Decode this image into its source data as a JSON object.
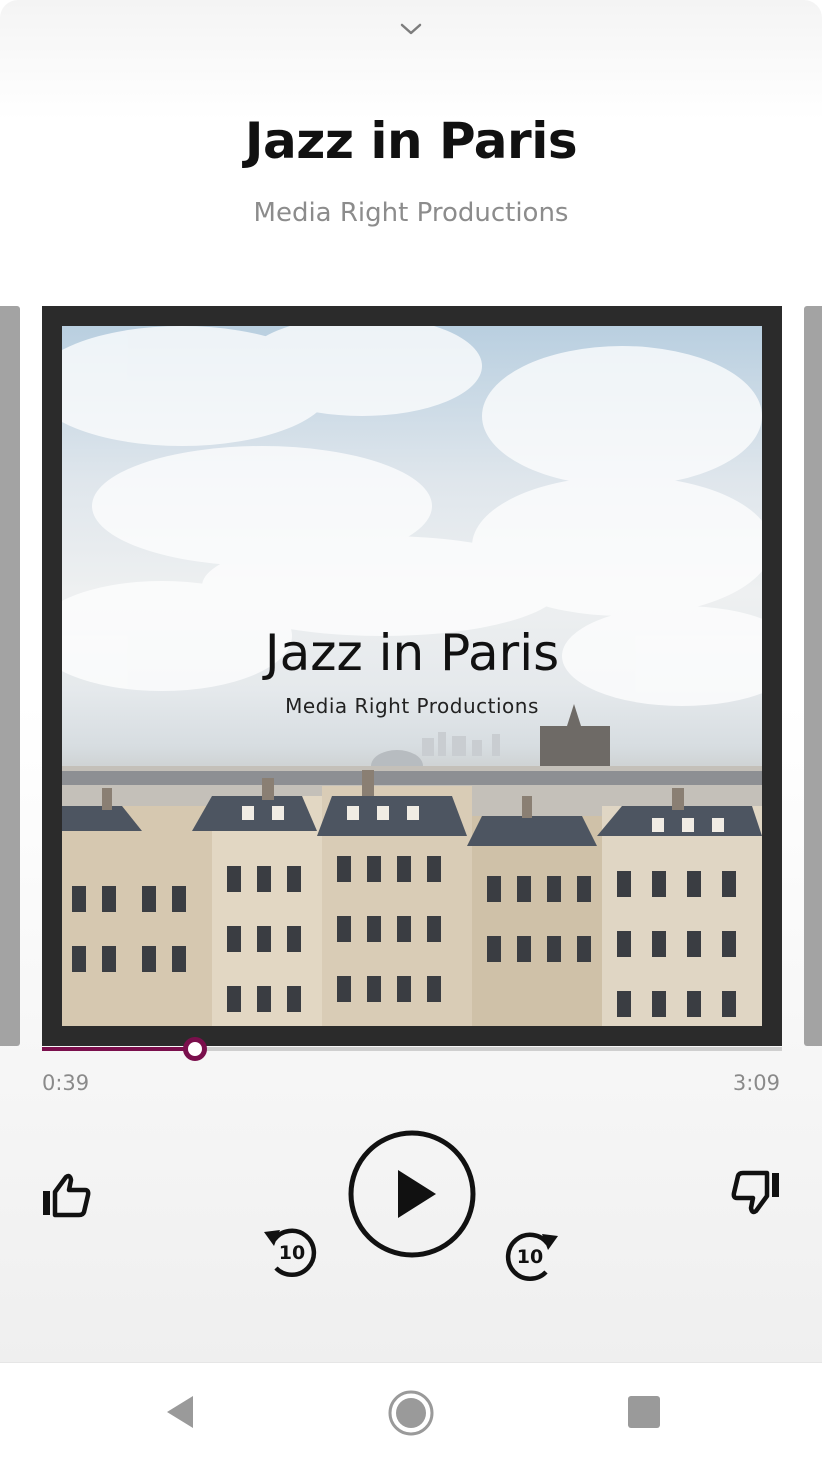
{
  "player": {
    "title": "Jazz in Paris",
    "artist": "Media Right Productions",
    "elapsed": "0:39",
    "duration": "3:09",
    "progress_fraction": 0.2063,
    "accent_color": "#7a0f4c"
  },
  "artwork": {
    "title": "Jazz in Paris",
    "subtitle": "Media Right Productions"
  },
  "controls": {
    "rewind_seconds": "10",
    "forward_seconds": "10",
    "icons": [
      "chevron-down-icon",
      "thumbs-up-icon",
      "replay-10-icon",
      "play-icon",
      "forward-10-icon",
      "thumbs-down-icon"
    ]
  },
  "system_nav": {
    "icons": [
      "back-icon",
      "home-icon",
      "recents-icon"
    ]
  }
}
